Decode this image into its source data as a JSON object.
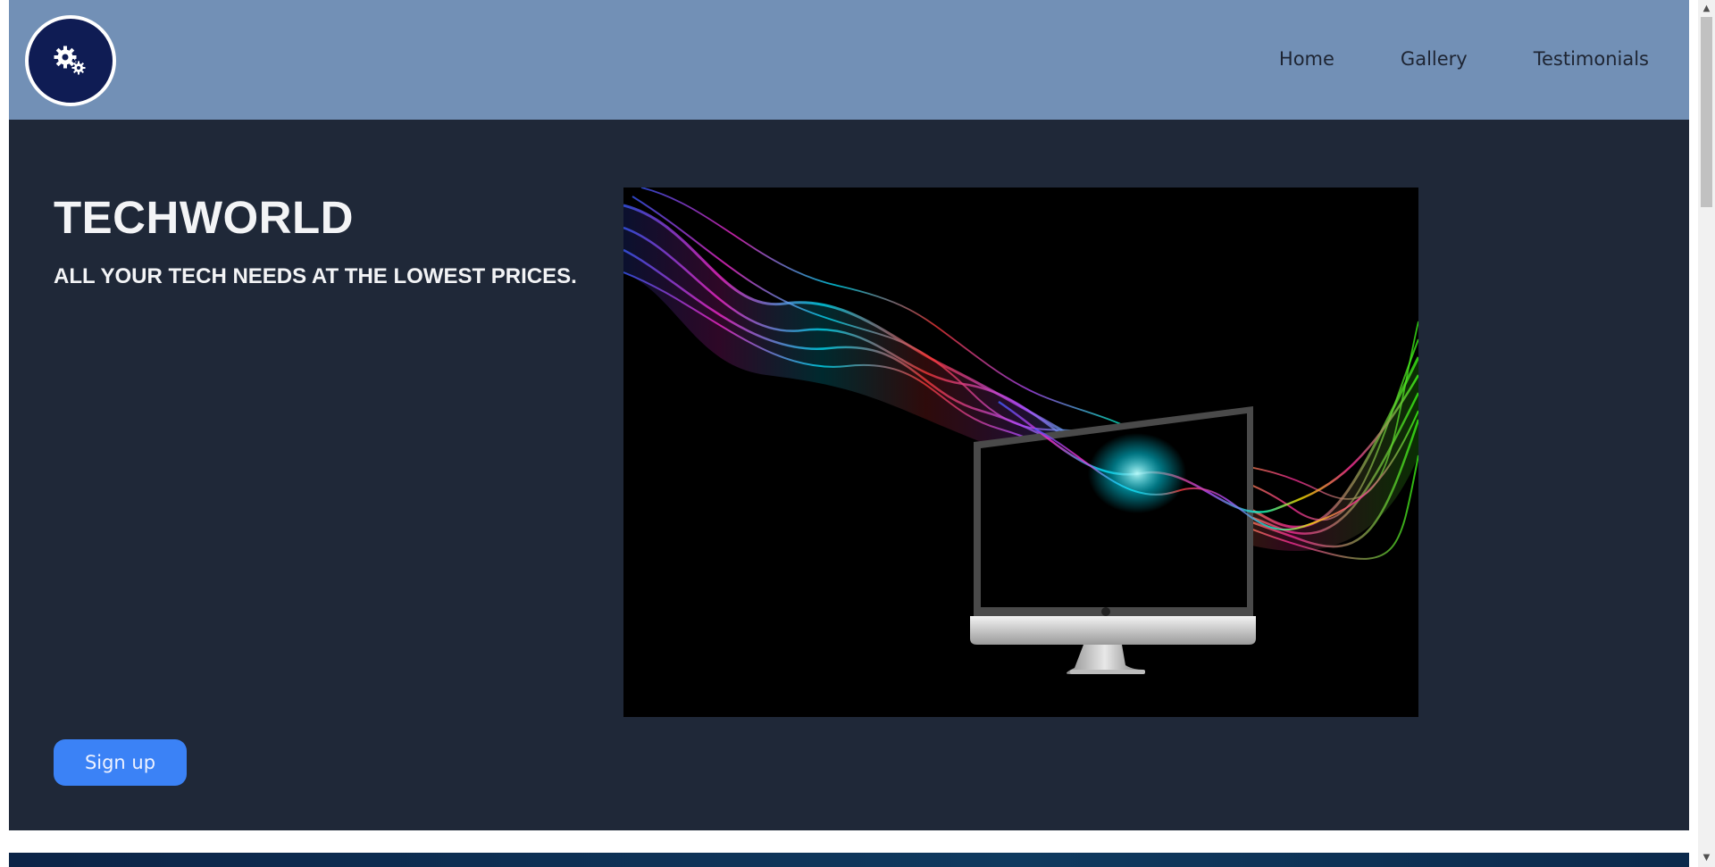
{
  "header": {
    "logo_icon": "gears-icon",
    "nav": [
      {
        "label": "Home"
      },
      {
        "label": "Gallery"
      },
      {
        "label": "Testimonials"
      }
    ]
  },
  "hero": {
    "title": "TECHWORLD",
    "subtitle": "ALL YOUR TECH NEEDS AT THE LOWEST PRICES.",
    "image_icon": "computer-monitor-with-rainbow-smoke-image",
    "signup_label": "Sign up"
  },
  "scrollbar": {
    "up_icon": "scroll-up-arrow-icon",
    "down_icon": "scroll-down-arrow-icon"
  },
  "colors": {
    "header_bg": "#7290b6",
    "hero_bg": "#1f2838",
    "logo_bg": "#0f1c54",
    "button_bg": "#3b82f6"
  }
}
